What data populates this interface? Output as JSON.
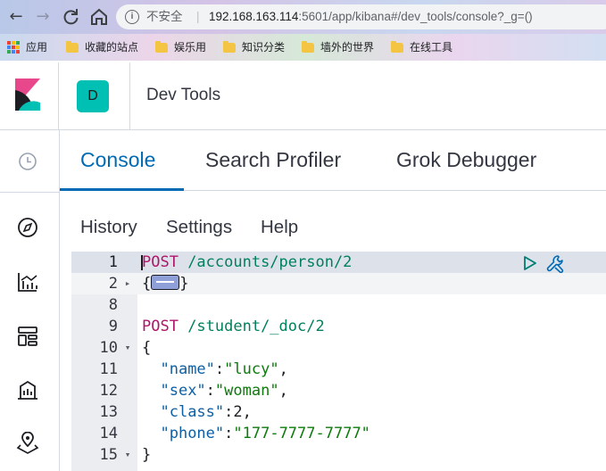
{
  "browser": {
    "back_icon": "arrow-left-icon",
    "forward_icon": "arrow-right-icon",
    "reload_icon": "reload-icon",
    "home_icon": "home-icon",
    "security_label": "不安全",
    "separator": "|",
    "url_host": "192.168.163.114",
    "url_path": ":5601/app/kibana#/dev_tools/console?_g=()"
  },
  "bookmarks": [
    {
      "label": "应用",
      "icon": "apps-icon"
    },
    {
      "label": "收藏的站点",
      "icon": "folder-icon"
    },
    {
      "label": "娱乐用",
      "icon": "folder-icon"
    },
    {
      "label": "知识分类",
      "icon": "folder-icon"
    },
    {
      "label": "墙外的世界",
      "icon": "folder-icon"
    },
    {
      "label": "在线工具",
      "icon": "folder-icon"
    }
  ],
  "header": {
    "logo": "kibana-logo",
    "space_initial": "D",
    "app_title": "Dev Tools"
  },
  "sidenav": {
    "items": [
      {
        "icon": "clock-icon",
        "name": "recently-viewed"
      },
      {
        "icon": "compass-icon",
        "name": "discover"
      },
      {
        "icon": "visualize-icon",
        "name": "visualize"
      },
      {
        "icon": "dashboard-icon",
        "name": "dashboard"
      },
      {
        "icon": "canvas-icon",
        "name": "canvas"
      },
      {
        "icon": "maps-icon",
        "name": "maps"
      }
    ]
  },
  "tabs": [
    {
      "label": "Console",
      "active": true
    },
    {
      "label": "Search Profiler",
      "active": false
    },
    {
      "label": "Grok Debugger",
      "active": false
    }
  ],
  "menu": {
    "history": "History",
    "settings": "Settings",
    "help": "Help"
  },
  "editor": {
    "lines": [
      {
        "num": "1",
        "fold": "",
        "kind": "request",
        "method": "POST",
        "path": " /accounts/person/2"
      },
      {
        "num": "2",
        "fold": "▸",
        "kind": "folded",
        "open": "{",
        "close": "}"
      },
      {
        "num": "8",
        "fold": "",
        "kind": "blank"
      },
      {
        "num": "9",
        "fold": "",
        "kind": "request",
        "method": "POST",
        "path": " /student/_doc/2"
      },
      {
        "num": "10",
        "fold": "▾",
        "kind": "plain",
        "text": "{"
      },
      {
        "num": "11",
        "fold": "",
        "kind": "pair",
        "key": "\"name\"",
        "value": "\"lucy\"",
        "value_type": "string",
        "trail": ","
      },
      {
        "num": "12",
        "fold": "",
        "kind": "pair",
        "key": "\"sex\"",
        "value": "\"woman\"",
        "value_type": "string",
        "trail": ","
      },
      {
        "num": "13",
        "fold": "",
        "kind": "pair",
        "key": "\"class\"",
        "value": "2",
        "value_type": "number",
        "trail": ","
      },
      {
        "num": "14",
        "fold": "",
        "kind": "pair",
        "key": "\"phone\"",
        "value": "\"177-7777-7777\"",
        "value_type": "string",
        "trail": ""
      },
      {
        "num": "15",
        "fold": "▾",
        "kind": "plain",
        "text": "}"
      }
    ],
    "actions": {
      "run_icon": "play-icon",
      "settings_icon": "wrench-icon"
    }
  },
  "colors": {
    "accent": "#006bb4",
    "space_avatar": "#00bfb3",
    "method": "#b0156a",
    "path": "#00805e",
    "string": "#0e7a0d"
  }
}
